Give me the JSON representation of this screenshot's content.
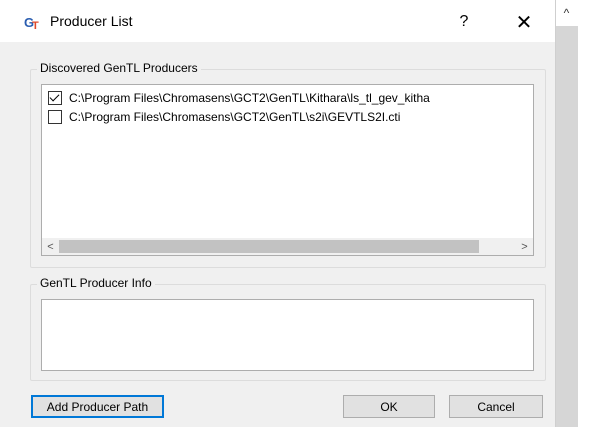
{
  "window": {
    "title": "Producer List",
    "help_label": "?",
    "close_label": "✕"
  },
  "producers": {
    "group_label": "Discovered GenTL Producers",
    "items": [
      {
        "path": "C:\\Program Files\\Chromasens\\GCT2\\GenTL\\Kithara\\ls_tl_gev_kitha",
        "checked": true
      },
      {
        "path": "C:\\Program Files\\Chromasens\\GCT2\\GenTL\\s2i\\GEVTLS2I.cti",
        "checked": false
      }
    ],
    "scroll_left": "<",
    "scroll_right": ">"
  },
  "info": {
    "group_label": "GenTL Producer Info",
    "text": ""
  },
  "buttons": {
    "add_path": "Add Producer Path",
    "ok": "OK",
    "cancel": "Cancel"
  },
  "parent_scroll": {
    "up_arrow": "^"
  },
  "colors": {
    "accent": "#0078d7",
    "dialog_bg": "#f0f0f0",
    "icon_red": "#e04a2a",
    "icon_blue": "#2a5db0"
  }
}
